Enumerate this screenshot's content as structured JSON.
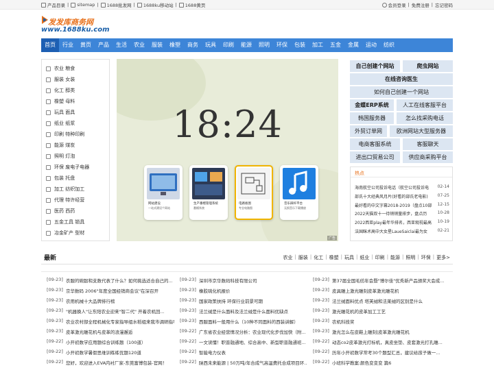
{
  "topbar": {
    "left": [
      "产品目录",
      "sitemap",
      "1688批发网",
      "1688ku移动站",
      "1688黄页"
    ],
    "right": [
      "会员登录",
      "免费注册",
      "忘记密码"
    ]
  },
  "logo": {
    "title": "发发库商务网",
    "url": "www.1688ku.com"
  },
  "nav": [
    "首页",
    "行业",
    "黄页",
    "产品",
    "生活",
    "农业",
    "服装",
    "橡塑",
    "商务",
    "玩具",
    "印刷",
    "能源",
    "照明",
    "环保",
    "包装",
    "加工",
    "五金",
    "金属",
    "运动",
    "纺织"
  ],
  "categories": [
    "农业 粮食",
    "服装 女装",
    "化工 醇类",
    "橡塑 母料",
    "玩具 面具",
    "纸业 纸浆",
    "印刷 特种印刷",
    "能源 煤炭",
    "照明 灯泡",
    "环保 废电子电器",
    "包装 托盘",
    "加工 纺织加工",
    "代理 特许经营",
    "医药 西药",
    "五金工具 锁具",
    "冶金矿产 型材"
  ],
  "banner": {
    "time": "18:24",
    "cards": [
      {
        "label": "网站建设",
        "desc": "一站式建设个网站",
        "icon": "desktop-icon"
      },
      {
        "label": "生产番榴管理系统",
        "desc": "番榴系统",
        "icon": "dashboard-icon"
      },
      {
        "label": "电路板图",
        "desc": "专业电路图",
        "icon": "circuit-icon"
      },
      {
        "label": "音乐踩杆平台",
        "desc": "无损音乐下载播放",
        "icon": "music-icon"
      }
    ],
    "ad_tag": "广告"
  },
  "link_buttons": [
    [
      "自己创建个网站",
      "爬虫网站"
    ],
    [
      "在线咨询医生"
    ],
    [
      "如何自己创建一个网站"
    ],
    [
      "金蝶ERP系统",
      "人工在线客服平台"
    ],
    [
      "韩国服务器",
      "怎么找采购电话"
    ],
    [
      "外贸订单网",
      "欧洲网站大型服务器"
    ],
    [
      "电商客服系统",
      "客服聊天"
    ],
    [
      "进出口贸易公司",
      "供应商采购平台"
    ]
  ],
  "hot": {
    "tab": "热点",
    "items": [
      {
        "title": "海南航空公司投诉电话（航空公司投诉电",
        "date": "02-14"
      },
      {
        "title": "部氏十大经典风月片(好看的部氏老电影)",
        "date": "07-25"
      },
      {
        "title": "最好看的中文字幕2018-2019（盘点10部",
        "date": "12-15"
      },
      {
        "title": "2022天猫双十一待销销量排步，盘点历",
        "date": "10-28"
      },
      {
        "title": "2022西亚play最年华排名，西亚观视最高",
        "date": "10-19"
      },
      {
        "title": "法国眯术高中大女星LaueSaiclai最为女",
        "date": "02-21"
      }
    ]
  },
  "latest": {
    "title": "最新",
    "cats": [
      "农业",
      "服装",
      "化工",
      "橡塑",
      "玩具",
      "纸业",
      "印刷",
      "能源",
      "照明",
      "环保",
      "更多>"
    ]
  },
  "news": {
    "col1": [
      {
        "date": "[09-23]",
        "title": "衣服的碗毂和支数代表了什么？如何挑选适合自己的..."
      },
      {
        "date": "[09-23]",
        "title": "京华数码 2006\"年度全国经销商会议\"在深召开"
      },
      {
        "date": "[09-23]",
        "title": "农用机械十大品牌排行榜"
      },
      {
        "date": "[09-23]",
        "title": "\"机器换人\"让东阳农业迎来\"智二代\" 开着农机回..."
      },
      {
        "date": "[09-23]",
        "title": "农业农村部全程机械化专家指导组水稻组来我市调研指导"
      },
      {
        "date": "[09-23]",
        "title": "皮革激光雕花机与皮革的浪漫邂逅"
      },
      {
        "date": "[09-22]",
        "title": "小开初数学应用题综合训练题（100道）"
      },
      {
        "date": "[09-22]",
        "title": "小开初数学暑假思维训练练优题120道"
      },
      {
        "date": "[09-22]",
        "title": "您好，欢迎进入EVA内衬厂家-东莞富博包装-官网！"
      }
    ],
    "col2": [
      {
        "date": "[09-23]",
        "title": "深圳市京华数码科技有限公司"
      },
      {
        "date": "[09-23]",
        "title": "橡胶硫化机报价"
      },
      {
        "date": "[09-23]",
        "title": "国家政策扶持 环保行业前景可期"
      },
      {
        "date": "[09-23]",
        "title": "法兰绒是什么面料及法兰绒是什么面料优缺点"
      },
      {
        "date": "[09-23]",
        "title": "西服面料一般用什么（10种不同面料的西装讲解）"
      },
      {
        "date": "[09-22]",
        "title": "广东省农业经营情况分析：农业现代化步伐加快（附..."
      },
      {
        "date": "[09-22]",
        "title": "一文读懂！职普融通地、综合高中、新型职普融通班..."
      },
      {
        "date": "[09-22]",
        "title": "智能电力仪表"
      },
      {
        "date": "[09-22]",
        "title": "陕西未来能源 | 50万吨/年合成气高温费托合成项目环..."
      }
    ],
    "col3": [
      {
        "date": "[09-23]",
        "title": "第37届全国毛纺年会暨\"博尔佳\"优秀新产品颁奖大会成..."
      },
      {
        "date": "[09-23]",
        "title": "皮具雕上激光雕刻皮革激光雕花机"
      },
      {
        "date": "[09-23]",
        "title": "法兰绒面料优点 塔芙绒和法莱绒的区别是什么"
      },
      {
        "date": "[09-23]",
        "title": "激光雕花机的皮革加工工艺"
      },
      {
        "date": "[09-23]",
        "title": "农机科技奖"
      },
      {
        "date": "[09-23]",
        "title": "激光怎么在皮鞋上雕刻|皮革激光雕花机"
      },
      {
        "date": "[09-22]",
        "title": "动态co2皮革激光打标机，真皮坐垫、皮套激光打孔雕..."
      },
      {
        "date": "[09-22]",
        "title": "历年小开初数学常考30个题型汇总，建议给孩子做一..."
      },
      {
        "date": "[09-22]",
        "title": "小班科学教案:颜色变变变 篇6"
      }
    ]
  }
}
